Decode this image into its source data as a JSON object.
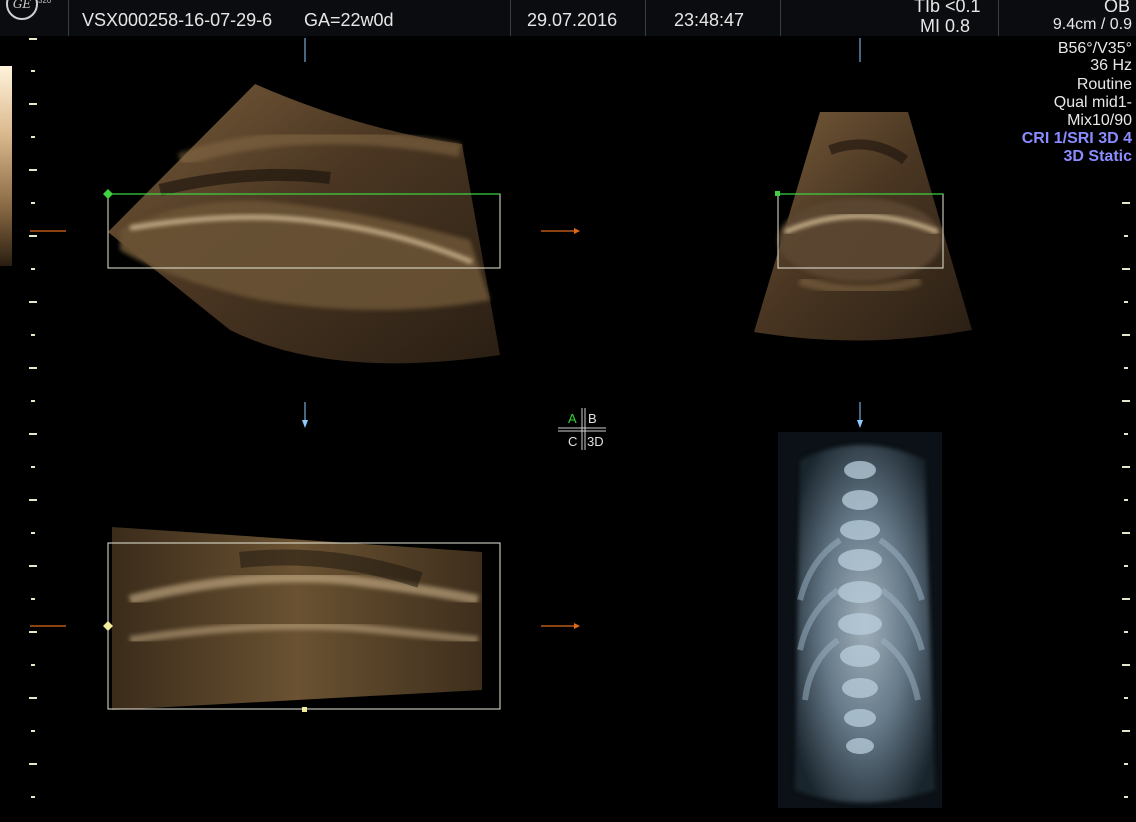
{
  "header": {
    "logo_text": "GE",
    "logo_sub": "320",
    "patient_id": "VSX000258-16-07-29-6",
    "gestational_age": "GA=22w0d",
    "date": "29.07.2016",
    "time": "23:48:47",
    "tib": "TIb <0.1",
    "mi": "MI  0.8",
    "exam": "OB"
  },
  "right_panel": {
    "depth": "9.4cm / 0.9",
    "angles": "B56°/V35°",
    "frame_rate": "36 Hz",
    "preset": "Routine",
    "quality": "Qual mid1-",
    "mix": "Mix10/90",
    "cri_sri": "CRI 1/SRI 3D 4",
    "mode": "3D Static"
  },
  "quad_labels": {
    "a": "A",
    "b": "B",
    "c": "C",
    "d": "3D"
  },
  "colors": {
    "roi_green": "#3fd13f",
    "roi_white": "#e8e8d8",
    "arrow_orange": "#e06a1a",
    "arrow_blue": "#8ecbff",
    "active_quad": "#36d236"
  }
}
